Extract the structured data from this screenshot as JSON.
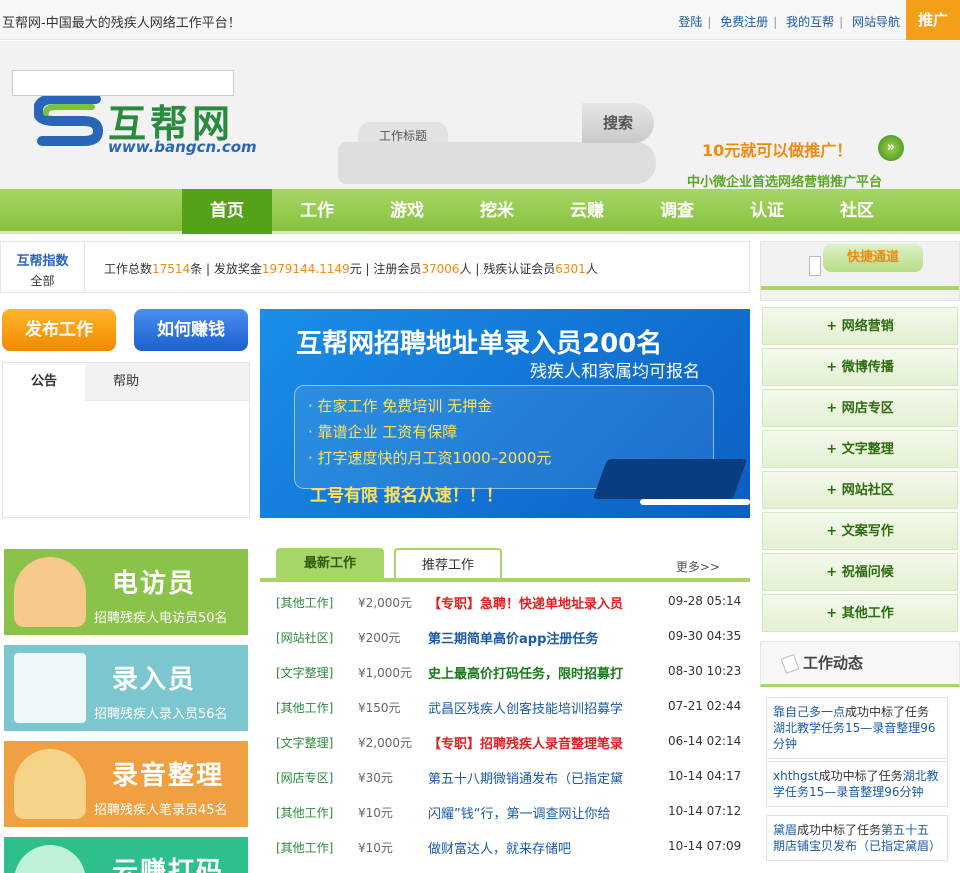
{
  "topbar": {
    "welcome": "互帮网-中国最大的残疾人网络工作平台！",
    "links": [
      "登陆",
      "免费注册",
      "我的互帮",
      "网站导航"
    ],
    "promo": "推广"
  },
  "header": {
    "logo_text": "互帮网",
    "logo_url": "www.bangcn.com",
    "search_tab": "工作标题",
    "search_value": "",
    "search_button": "搜索",
    "ad_line1": "10元就可以做推广！",
    "ad_line2": "中小微企业首选网络营销推广平台",
    "colors": {
      "brand_green": "#86c23c",
      "brand_orange": "#f08a10",
      "link_blue": "#1a5aa6"
    }
  },
  "nav": {
    "items": [
      "首页",
      "工作",
      "游戏",
      "挖米",
      "云赚",
      "调查",
      "认证",
      "社区"
    ],
    "active": "首页"
  },
  "stats": {
    "label": "互帮指数",
    "sub": "全部",
    "p1": "工作总数",
    "v1": "17514",
    "u1": "条 | 发放奖金",
    "v2": "1979144.1149",
    "u2": "元 | 注册会员",
    "v3": "37006",
    "u3": "人 | 残疾认证会员",
    "v4": "6301",
    "u4": "人"
  },
  "actions": {
    "post": "发布工作",
    "earn": "如何赚钱"
  },
  "notice": {
    "tabs": [
      "公告",
      "帮助"
    ]
  },
  "banner": {
    "title": "互帮网招聘地址单录入员200名",
    "subtitle": "残疾人和家属均可报名",
    "bullets": [
      "· 在家工作 免费培训 无押金",
      "· 靠谱企业 工资有保障",
      "· 打字速度快的月工资1000–2000元"
    ],
    "cta": "工号有限 报名从速！！！"
  },
  "cards": [
    {
      "title": "电访员",
      "desc": "招聘残疾人电访员50名",
      "color": "#8bc34a"
    },
    {
      "title": "录入员",
      "desc": "招聘残疾人录入员56名",
      "color": "#7cc6cf"
    },
    {
      "title": "录音整理",
      "desc": "招聘残疾人笔录员45名",
      "color": "#f0a040"
    },
    {
      "title": "云赚打码",
      "desc": "",
      "color": "#2fbf8a"
    }
  ],
  "jobs": {
    "tabs": [
      "最新工作",
      "推荐工作"
    ],
    "more": "更多>>",
    "rows": [
      {
        "cat": "[其他工作]",
        "pay": "¥2,000元",
        "title": "【专职】急聘！快递单地址录入员",
        "time": "09-28 05:14",
        "color": "#e02020"
      },
      {
        "cat": "[网站社区]",
        "pay": "¥200元",
        "title": "第三期简单高价app注册任务",
        "time": "09-30 04:35",
        "color": "#1a5aa6"
      },
      {
        "cat": "[文字整理]",
        "pay": "¥1,000元",
        "title": "史上最高价打码任务，限时招募打",
        "time": "08-30 10:23",
        "color": "#1a7a1a"
      },
      {
        "cat": "[其他工作]",
        "pay": "¥150元",
        "title": "武昌区残疾人创客技能培训招募学",
        "time": "07-21 02:44",
        "color": "#1a5aa6"
      },
      {
        "cat": "[文字整理]",
        "pay": "¥2,000元",
        "title": "【专职】招聘残疾人录音整理笔录",
        "time": "06-14 02:14",
        "color": "#e02020"
      },
      {
        "cat": "[网店专区]",
        "pay": "¥30元",
        "title": "第五十八期微销通发布（已指定黛",
        "time": "10-14 04:17",
        "color": "#1a5aa6"
      },
      {
        "cat": "[其他工作]",
        "pay": "¥10元",
        "title": "闪耀”钱“行，第一调查网让你给",
        "time": "10-14 07:12",
        "color": "#1a5aa6"
      },
      {
        "cat": "[其他工作]",
        "pay": "¥10元",
        "title": "做财富达人，就来存储吧",
        "time": "10-14 07:09",
        "color": "#1a5aa6"
      }
    ]
  },
  "quick": {
    "title": "快捷通道",
    "items": [
      "+ 网络营销",
      "+ 微博传播",
      "+ 网店专区",
      "+ 文字整理",
      "+ 网站社区",
      "+ 文案写作",
      "+ 祝福问候",
      "+ 其他工作"
    ]
  },
  "dynamics": {
    "title": "工作动态",
    "items": [
      {
        "user": "靠自己多一点",
        "mid": "成功中标了任务",
        "task": "湖北教学任务15—录音整理96分钟"
      },
      {
        "user": "xhthgst",
        "mid": "成功中标了任务",
        "task": "湖北教学任务15—录音整理96分钟"
      },
      {
        "user": "黛眉",
        "mid": "成功中标了任务",
        "task": "第五十五期店铺宝贝发布（已指定黛眉）"
      }
    ]
  }
}
